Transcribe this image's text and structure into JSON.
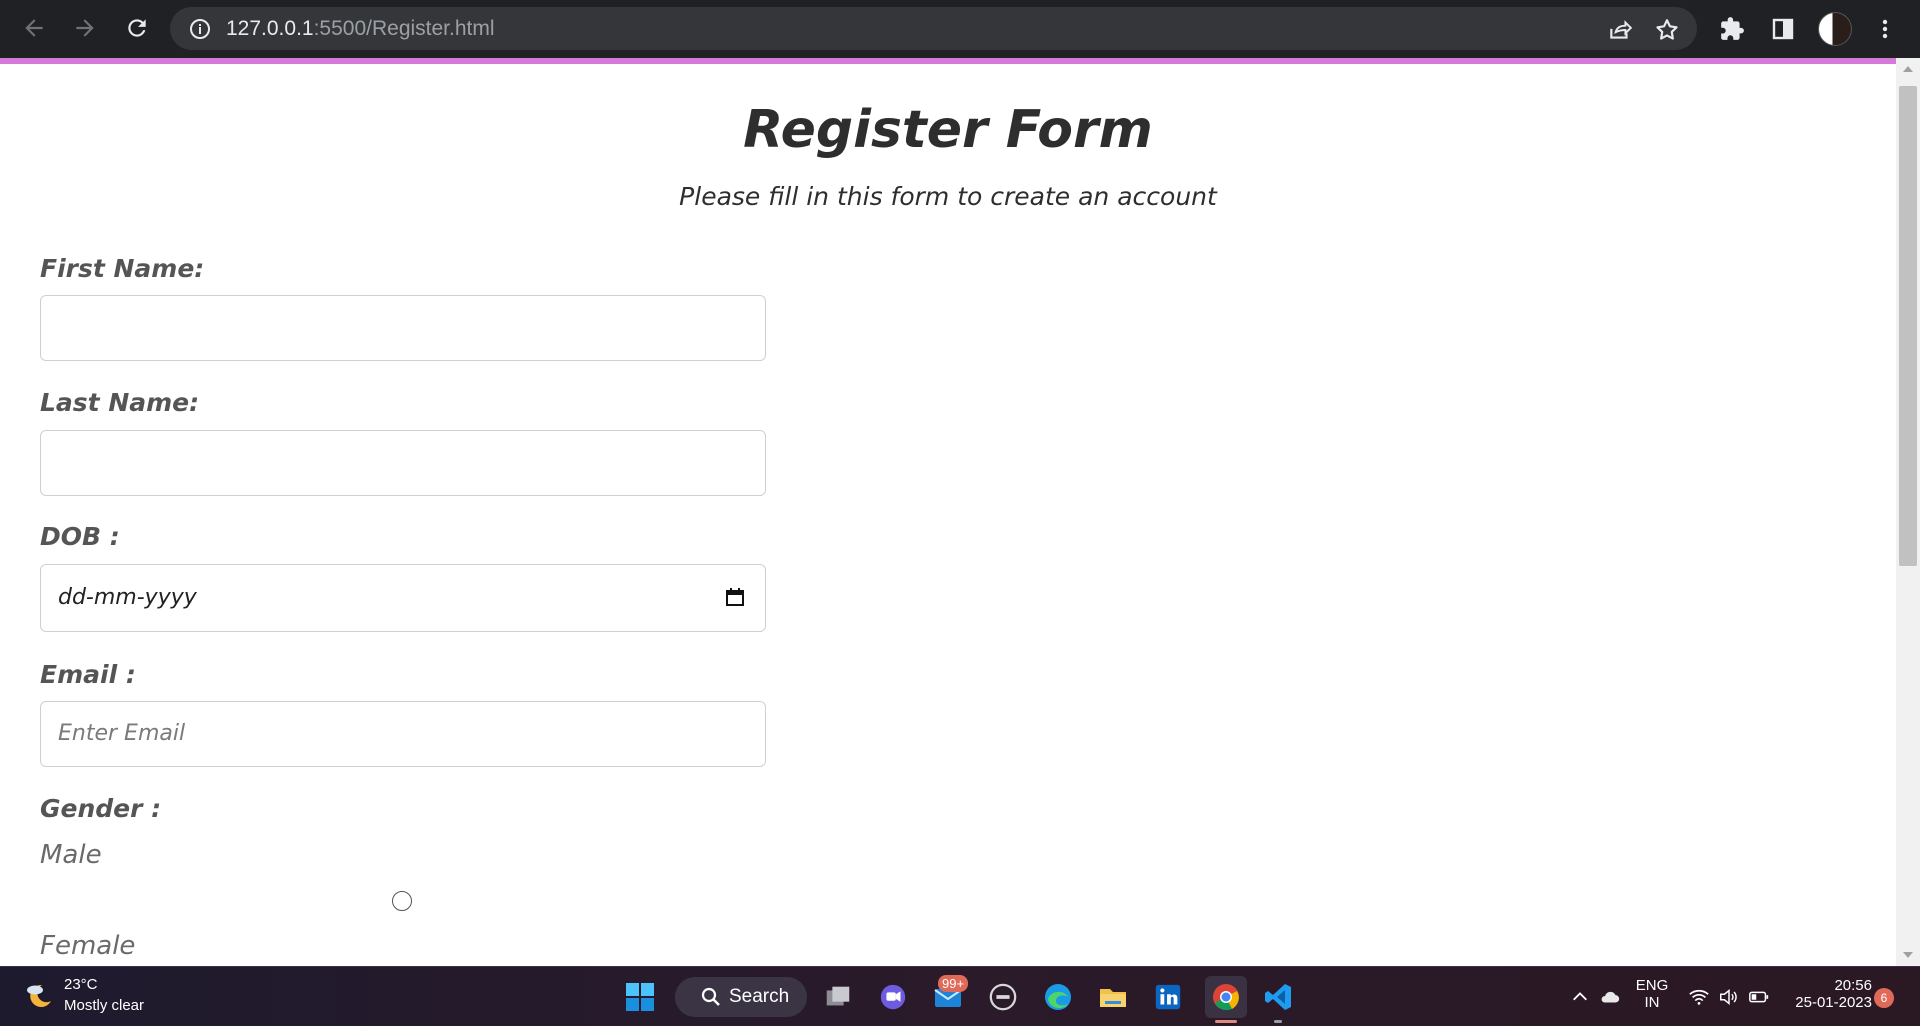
{
  "browser": {
    "url_host": "127.0.0.1",
    "url_path": ":5500/Register.html"
  },
  "form": {
    "title": "Register Form",
    "subtitle": "Please fill in this form to create an account",
    "first_name_label": "First Name:",
    "first_name_value": "",
    "last_name_label": "Last Name:",
    "last_name_value": "",
    "dob_label": "DOB :",
    "dob_placeholder": "dd-mm-yyyy",
    "email_label": "Email :",
    "email_placeholder": "Enter Email",
    "gender_label": "Gender :",
    "gender_options": [
      "Male",
      "Female"
    ]
  },
  "taskbar": {
    "weather_temp": "23°C",
    "weather_desc": "Mostly clear",
    "search_label": "Search",
    "mail_badge": "99+",
    "lang_line1": "ENG",
    "lang_line2": "IN",
    "time": "20:56",
    "date": "25-01-2023",
    "notification_count": "6"
  },
  "colors": {
    "accent_line": "#d67ad9",
    "chrome_bg": "#202124",
    "text_dark": "#2e2e2e",
    "label_gray": "#555555"
  }
}
